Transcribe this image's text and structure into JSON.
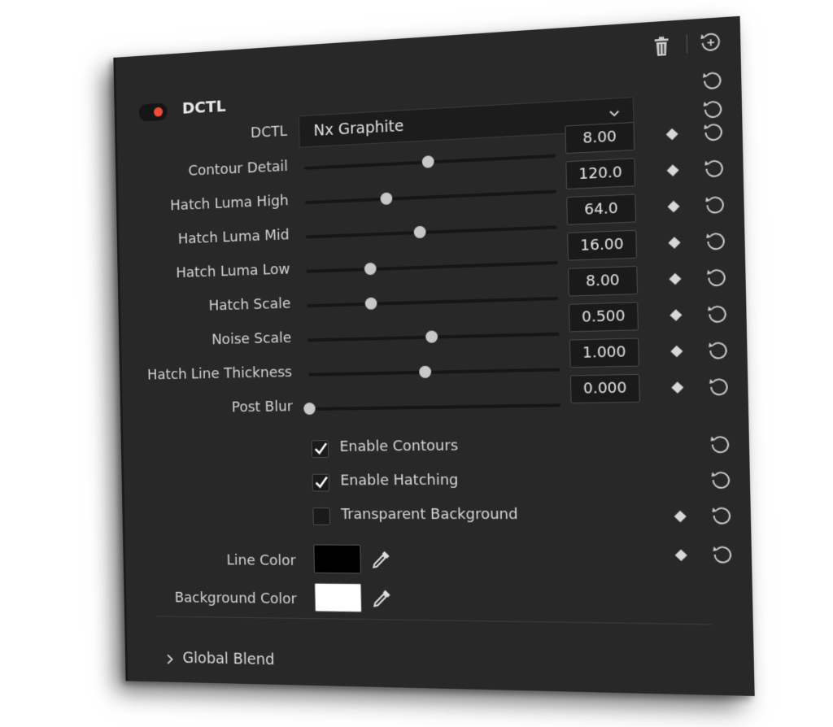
{
  "header": {
    "title": "DCTL",
    "enabled": true,
    "toggle_color": "#ee4b3a"
  },
  "dctl": {
    "label": "DCTL",
    "selected": "Nx Graphite"
  },
  "sliders": [
    {
      "label": "Contour Detail",
      "value": "8.00",
      "position": 0.5,
      "keyframe": true
    },
    {
      "label": "Hatch Luma High",
      "value": "120.0",
      "position": 0.33,
      "keyframe": true
    },
    {
      "label": "Hatch Luma Mid",
      "value": "64.0",
      "position": 0.46,
      "keyframe": true
    },
    {
      "label": "Hatch Luma Low",
      "value": "16.00",
      "position": 0.26,
      "keyframe": true
    },
    {
      "label": "Hatch Scale",
      "value": "8.00",
      "position": 0.26,
      "keyframe": true
    },
    {
      "label": "Noise Scale",
      "value": "0.500",
      "position": 0.5,
      "keyframe": true
    },
    {
      "label": "Hatch Line Thickness",
      "value": "1.000",
      "position": 0.47,
      "keyframe": true
    },
    {
      "label": "Post Blur",
      "value": "0.000",
      "position": 0.0,
      "keyframe": true
    }
  ],
  "checkboxes": [
    {
      "label": "Enable Contours",
      "checked": true
    },
    {
      "label": "Enable Hatching",
      "checked": true
    },
    {
      "label": "Transparent Background",
      "checked": false
    }
  ],
  "colors": [
    {
      "label": "Line Color",
      "value": "#000000"
    },
    {
      "label": "Background Color",
      "value": "#ffffff"
    }
  ],
  "footer": {
    "global_blend_label": "Global Blend"
  },
  "icons": {
    "delete": "trash-icon",
    "reset_all": "reset-all-icon",
    "reset": "reset-icon",
    "keyframe": "keyframe-diamond-icon",
    "picker": "eyedropper-icon",
    "expand": "chevron-right-icon"
  }
}
